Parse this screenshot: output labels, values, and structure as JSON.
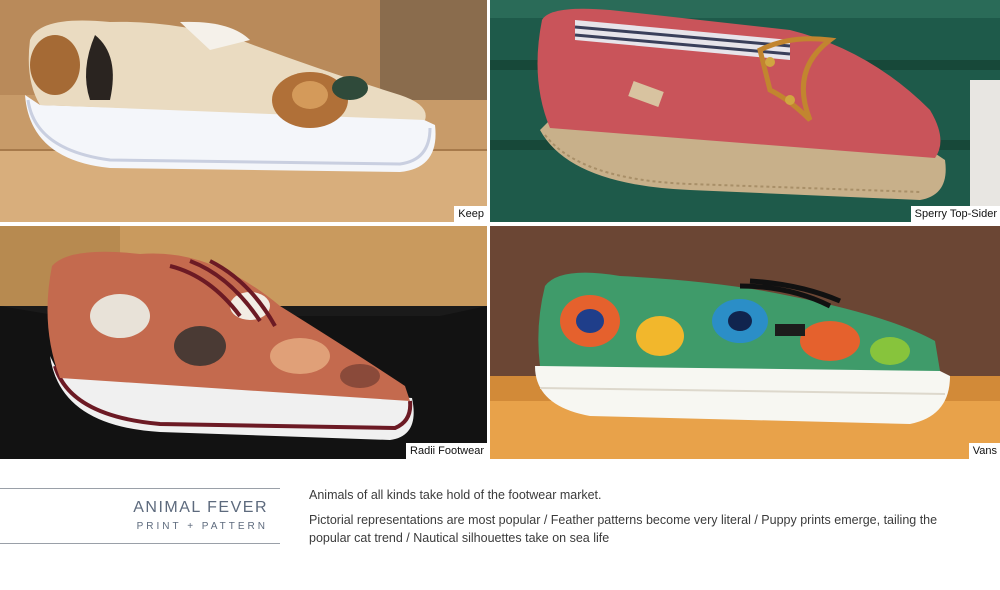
{
  "photos": [
    {
      "caption": "Keep",
      "subject": "canvas sneaker with dog print"
    },
    {
      "caption": "Sperry Top-Sider",
      "subject": "coral espadrille boat shoe with nautical line print"
    },
    {
      "caption": "Radii Footwear",
      "subject": "sneaker with cat print and burgundy laces"
    },
    {
      "caption": "Vans",
      "subject": "sneaker with peacock feather print"
    }
  ],
  "section": {
    "title": "ANIMAL FEVER",
    "subtitle": "PRINT + PATTERN"
  },
  "body": {
    "paragraph1": "Animals of all kinds take hold of the footwear market.",
    "paragraph2": "Pictorial representations are most popular / Feather patterns become very literal / Puppy prints emerge, tailing the popular cat trend / Nautical silhouettes take on sea life"
  },
  "colors": {
    "label_text": "#5d6a7d",
    "rule": "#9aa0a8",
    "body_text": "#3b3b3b"
  }
}
